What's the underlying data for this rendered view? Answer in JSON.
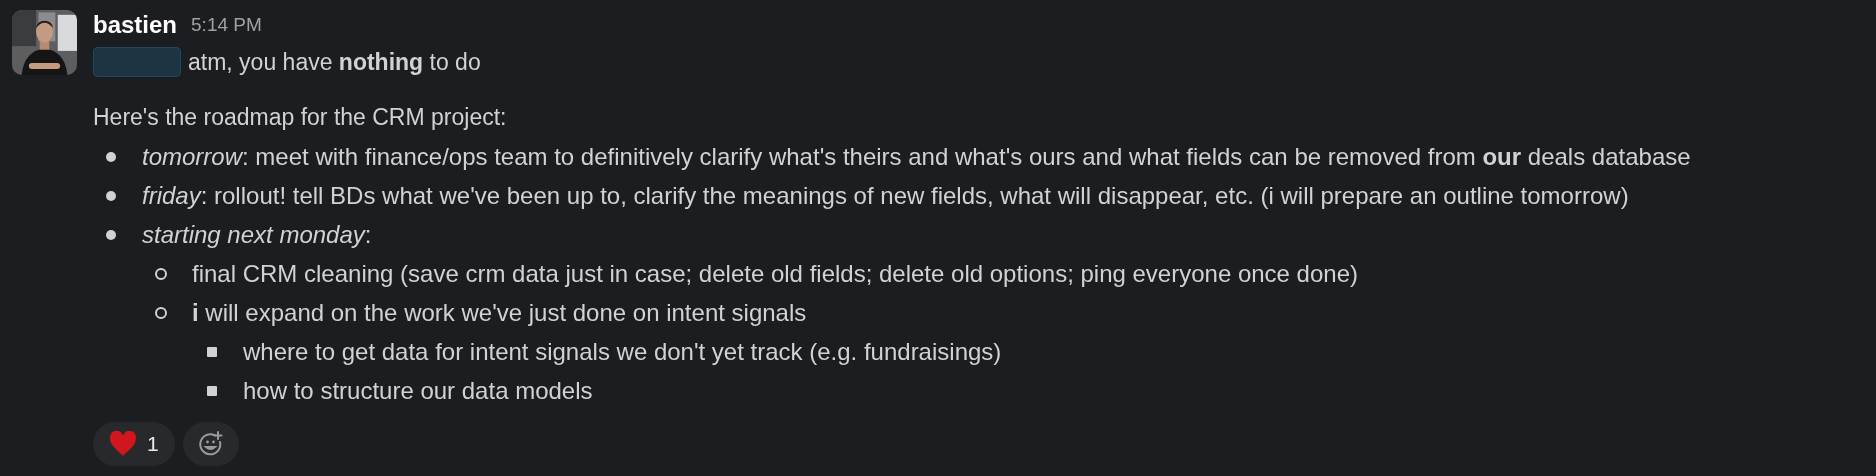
{
  "message": {
    "author": "bastien",
    "time": "5:14 PM",
    "mention": {
      "redacted": true
    },
    "lead": "atm, you have **nothing** to do",
    "intro": "Here's the roadmap for the CRM project:",
    "items": [
      {
        "text": "*tomorrow*: meet with finance/ops team to definitively clarify what's theirs and what's ours and what fields can be removed from **our** deals database"
      },
      {
        "text": "*friday*: rollout! tell BDs what we've been up to, clarify the meanings of new fields, what will disappear, etc. (i will prepare an outline tomorrow)"
      },
      {
        "text": "*starting next monday*:",
        "children": [
          {
            "text": "final CRM cleaning (save crm data just in case; delete old fields; delete old options; ping everyone once done)"
          },
          {
            "text": "**i** will expand on the work we've just done on intent signals",
            "children": [
              {
                "text": "where to get data for intent signals we don't yet track (e.g. fundraisings)"
              },
              {
                "text": "how to structure our data models"
              }
            ]
          }
        ]
      }
    ],
    "reactions": [
      {
        "kind": "heart",
        "count": "1",
        "selected": false
      }
    ],
    "add_reaction": true
  }
}
